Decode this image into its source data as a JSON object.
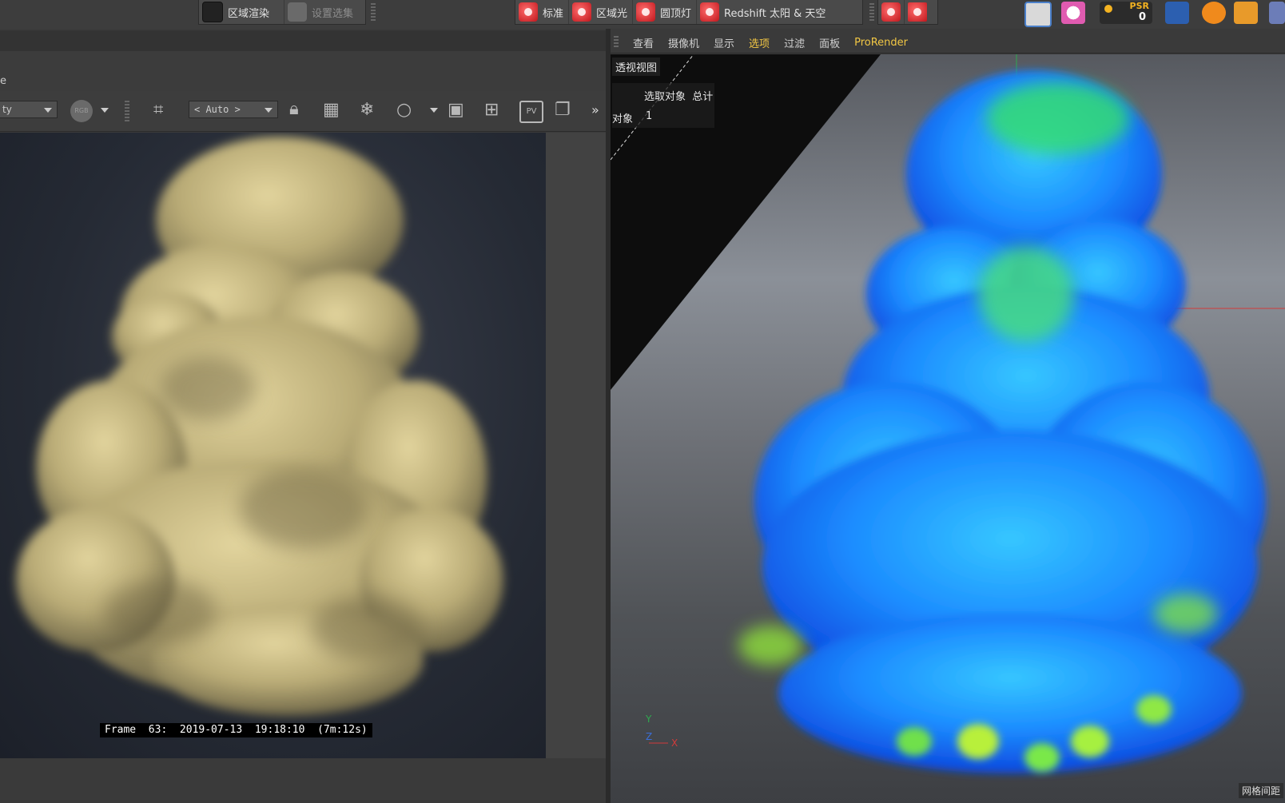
{
  "toolbar": {
    "region_render": "区域渲染",
    "set_selection": "设置选集",
    "standard": "标准",
    "area_light": "区域光",
    "dome_light": "圆顶灯",
    "redshift_sun_sky": "Redshift 太阳 & 天空",
    "psr_label": "PSR",
    "psr_value": "0"
  },
  "left_panel": {
    "label_partial": "e",
    "dropdown_partial": "ty",
    "rgb_label": "RGB",
    "auto_label": "< Auto >",
    "pv_label": "PV",
    "more_glyph": "»",
    "frame_info": "Frame  63:  2019-07-13  19:18:10  (7m:12s)"
  },
  "viewport": {
    "menu": [
      "查看",
      "摄像机",
      "显示",
      "选项",
      "过滤",
      "面板",
      "ProRender"
    ],
    "active_menu": "选项",
    "title": "透视视图",
    "hud_header": "选取对象  总计",
    "hud_row_label": "对象",
    "hud_row_value": "1",
    "axis_y": "Y",
    "axis_z": "Z",
    "axis_x": "X",
    "grid_label": "网格间距"
  },
  "colors": {
    "smoke_left": "#cfc08a",
    "smoke_right": "#1e8cff",
    "accent_yellow": "#f2c744",
    "icon_red": "#d3222a"
  }
}
